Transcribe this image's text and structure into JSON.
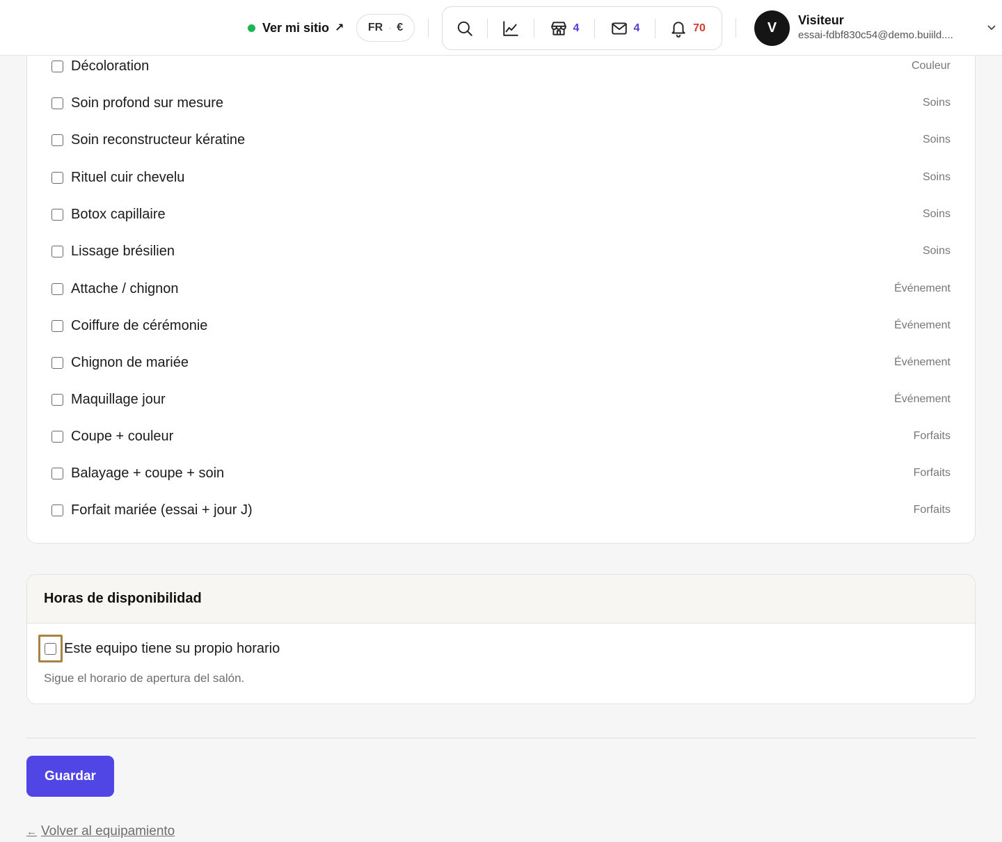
{
  "header": {
    "site_link_label": "Ver mi sitio",
    "site_link_icon": "arrow-up-right-icon",
    "status_color": "#1fb455",
    "locale": "FR",
    "locale_separator": "·",
    "currency": "€",
    "tools": [
      {
        "icon": "search-icon",
        "count": null
      },
      {
        "icon": "chart-icon",
        "count": null
      },
      {
        "icon": "store-icon",
        "count": "4"
      },
      {
        "icon": "mail-icon",
        "count": "4"
      },
      {
        "icon": "bell-icon",
        "count": "70"
      }
    ],
    "user": {
      "initial": "V",
      "name": "Visiteur",
      "email": "essai-fdbf830c54@demo.buiild...."
    }
  },
  "services": [
    {
      "name": "Décoloration",
      "category": "Couleur"
    },
    {
      "name": "Soin profond sur mesure",
      "category": "Soins"
    },
    {
      "name": "Soin reconstructeur kératine",
      "category": "Soins"
    },
    {
      "name": "Rituel cuir chevelu",
      "category": "Soins"
    },
    {
      "name": "Botox capillaire",
      "category": "Soins"
    },
    {
      "name": "Lissage brésilien",
      "category": "Soins"
    },
    {
      "name": "Attache / chignon",
      "category": "Événement"
    },
    {
      "name": "Coiffure de cérémonie",
      "category": "Événement"
    },
    {
      "name": "Chignon de mariée",
      "category": "Événement"
    },
    {
      "name": "Maquillage jour",
      "category": "Événement"
    },
    {
      "name": "Coupe + couleur",
      "category": "Forfaits"
    },
    {
      "name": "Balayage + coupe + soin",
      "category": "Forfaits"
    },
    {
      "name": "Forfait mariée (essai + jour J)",
      "category": "Forfaits"
    }
  ],
  "availability": {
    "title": "Horas de disponibilidad",
    "own_schedule_label": "Este equipo tiene su propio horario",
    "own_schedule_checked": false,
    "help_text": "Sigue el horario de apertura del salón."
  },
  "actions": {
    "save_label": "Guardar",
    "back_label": "Volver al equipamiento",
    "back_arrow": "←"
  },
  "colors": {
    "primary": "#4f46e5",
    "badge_blue": "#4b3fe0",
    "badge_red": "#d33a2c",
    "focus_ring": "#a8823f"
  }
}
